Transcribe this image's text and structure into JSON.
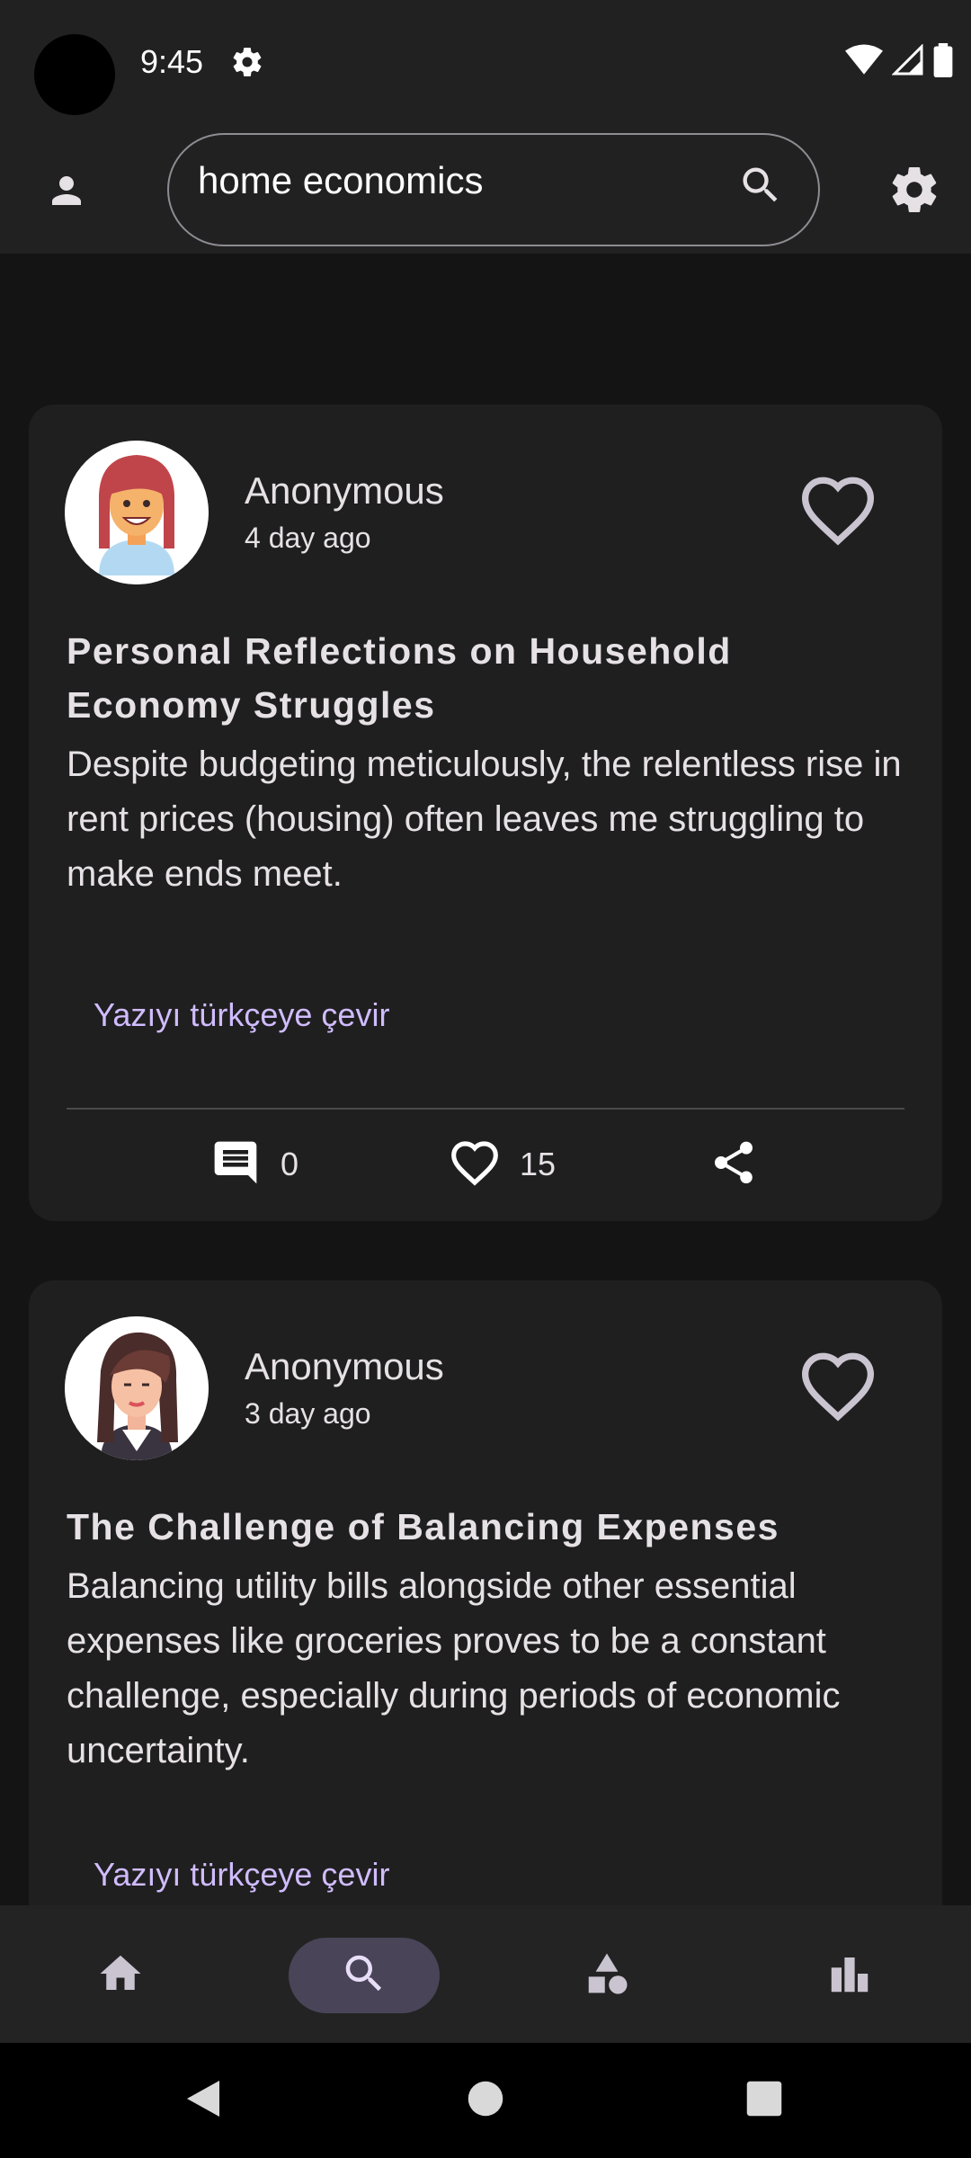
{
  "status_bar": {
    "time": "9:45",
    "icons": [
      "settings-icon",
      "wifi-icon",
      "signal-icon",
      "battery-icon"
    ]
  },
  "header": {
    "profile_icon": "person-icon",
    "search": {
      "value": "home economics",
      "icon": "search-icon"
    },
    "settings_icon": "gear-icon"
  },
  "posts": [
    {
      "author": "Anonymous",
      "time_ago": "4 day ago",
      "title": "Personal Reflections on Household Economy Struggles",
      "body": "Despite budgeting meticulously, the relentless rise in rent prices (housing) often leaves me struggling to make ends meet.",
      "translate_label": "Yazıyı türkçeye çevir",
      "comments": "0",
      "likes": "15"
    },
    {
      "author": "Anonymous",
      "time_ago": "3 day ago",
      "title": "The Challenge of Balancing Expenses",
      "body": "Balancing utility bills alongside other essential expenses like groceries proves to be a constant challenge, especially during periods of economic uncertainty.",
      "translate_label": "Yazıyı türkçeye çevir"
    }
  ],
  "bottom_nav": {
    "items": [
      "home-icon",
      "search-icon",
      "categories-icon",
      "stats-icon"
    ],
    "active": "search-icon"
  },
  "system_nav": [
    "back-icon",
    "home-circle-icon",
    "recents-icon"
  ],
  "colors": {
    "background": "#141414",
    "surface": "#1f1f1f",
    "accent": "#d0bcff",
    "active_indicator": "#4a4458"
  }
}
